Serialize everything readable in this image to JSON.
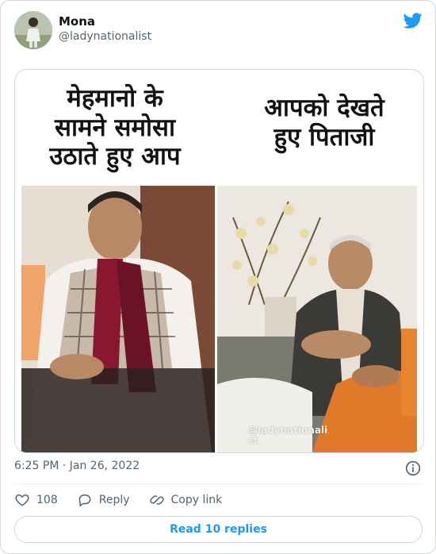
{
  "author": {
    "name": "Mona",
    "handle": "@ladynationalist"
  },
  "meme": {
    "caption_left": "मेहमानो के\nसामने समोसा\nउठाते हुए आप",
    "caption_right": "आपको देखते\nहुए पिताजी",
    "watermark": "@ladynationali\nst"
  },
  "timestamp": "6:25 PM · Jan 26, 2022",
  "actions": {
    "likes": "108",
    "reply_label": "Reply",
    "copy_label": "Copy link"
  },
  "read_replies": "Read 10 replies",
  "colors": {
    "accent": "#1d9bf0",
    "secondary_text": "#536471",
    "border": "#cfd9de"
  },
  "icons": [
    "twitter-bird-icon",
    "info-icon",
    "heart-icon",
    "reply-icon",
    "link-icon"
  ]
}
